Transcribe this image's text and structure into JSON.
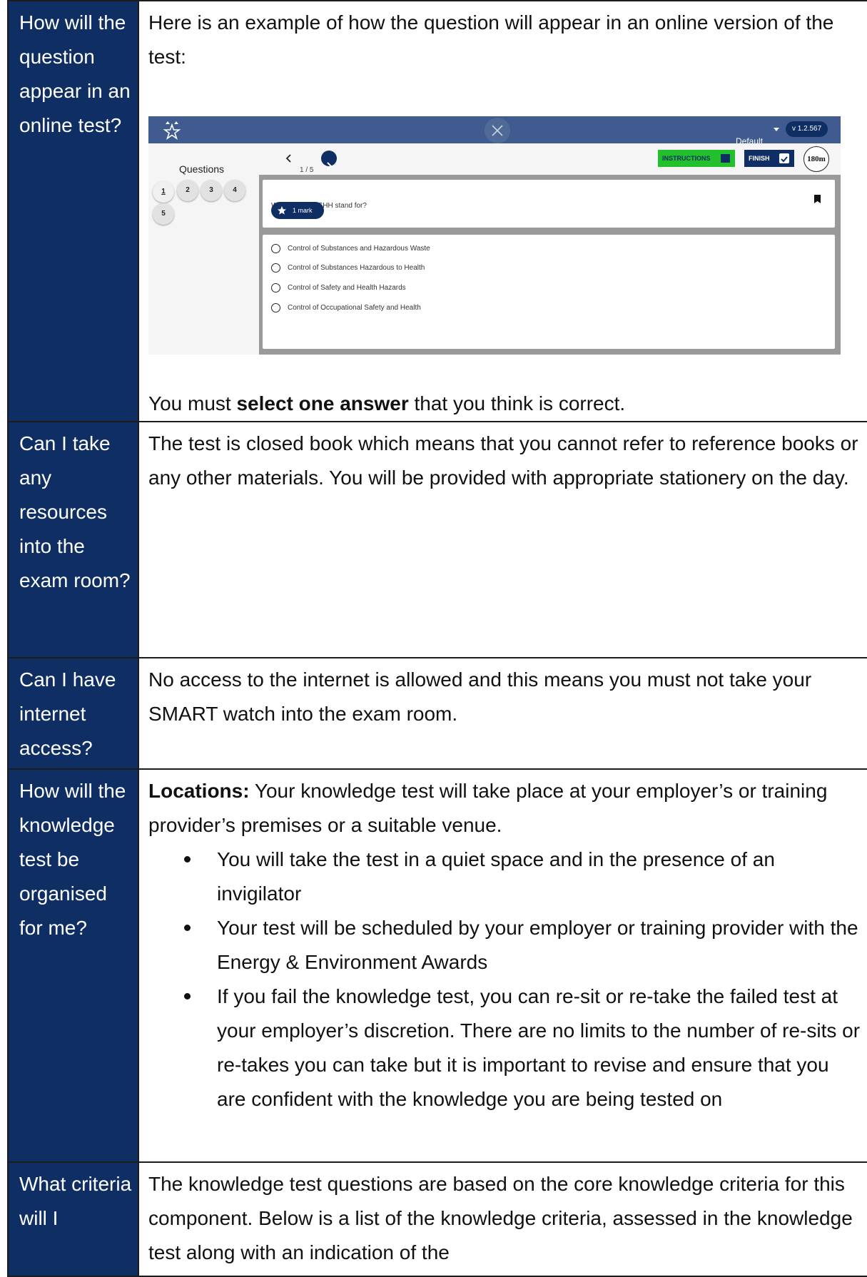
{
  "rows": [
    {
      "question": "How will the question appear in an online test?",
      "intro": "Here is an example of how the question will appear in an online version of the test:",
      "note_before": "You must ",
      "note_bold": "select one answer",
      "note_after": " that you think is correct."
    },
    {
      "question": "Can I take any resources into the exam room?",
      "answer": "The test is closed book which means that you cannot refer to reference books or any other materials. You will be provided with appropriate stationery on the day."
    },
    {
      "question": "Can I have internet access?",
      "answer": "No access to the internet is allowed and this means you must not take your SMART watch into the exam room."
    },
    {
      "question": "How will the knowledge test be organised for me?",
      "lead_bold": "Locations:",
      "lead_text": " Your knowledge test will take place at your employer’s or training provider’s premises or a suitable venue.",
      "bullets": [
        "You will take the test in a quiet space and in the presence of an invigilator",
        "Your test will be scheduled by your employer or training provider with the Energy & Environment Awards",
        "If you fail the knowledge test, you can re-sit or re-take the failed test at your employer’s discretion. There are no limits to the number of re-sits or re-takes you can take but it is important to revise and ensure that you are confident with the knowledge you are being tested on"
      ]
    },
    {
      "question": "What criteria will I",
      "answer": "The knowledge test questions are based on the core knowledge criteria for this component. Below is a list of the knowledge criteria, assessed in the knowledge test along with an indication of the"
    }
  ],
  "mock": {
    "profile": "Default",
    "version": "v 1.2.567",
    "questions_title": "Questions",
    "counter": "1 / 5",
    "instructions_label": "INSTRUCTIONS",
    "finish_label": "FINISH",
    "timer": "180m",
    "question_numbers": [
      "1",
      "2",
      "3",
      "4",
      "5"
    ],
    "question_text": "What does COSHH stand for?",
    "mark_label": "1 mark",
    "options": [
      "Control of Substances  and Hazardous Waste",
      "Control of Substances Hazardous to Health",
      "Control of Safety and Health Hazards",
      "Control of Occupational Safety and Health"
    ],
    "colors": {
      "navy": "#0f2e63",
      "topbar": "#3f5b8f",
      "green": "#22c02c"
    }
  }
}
